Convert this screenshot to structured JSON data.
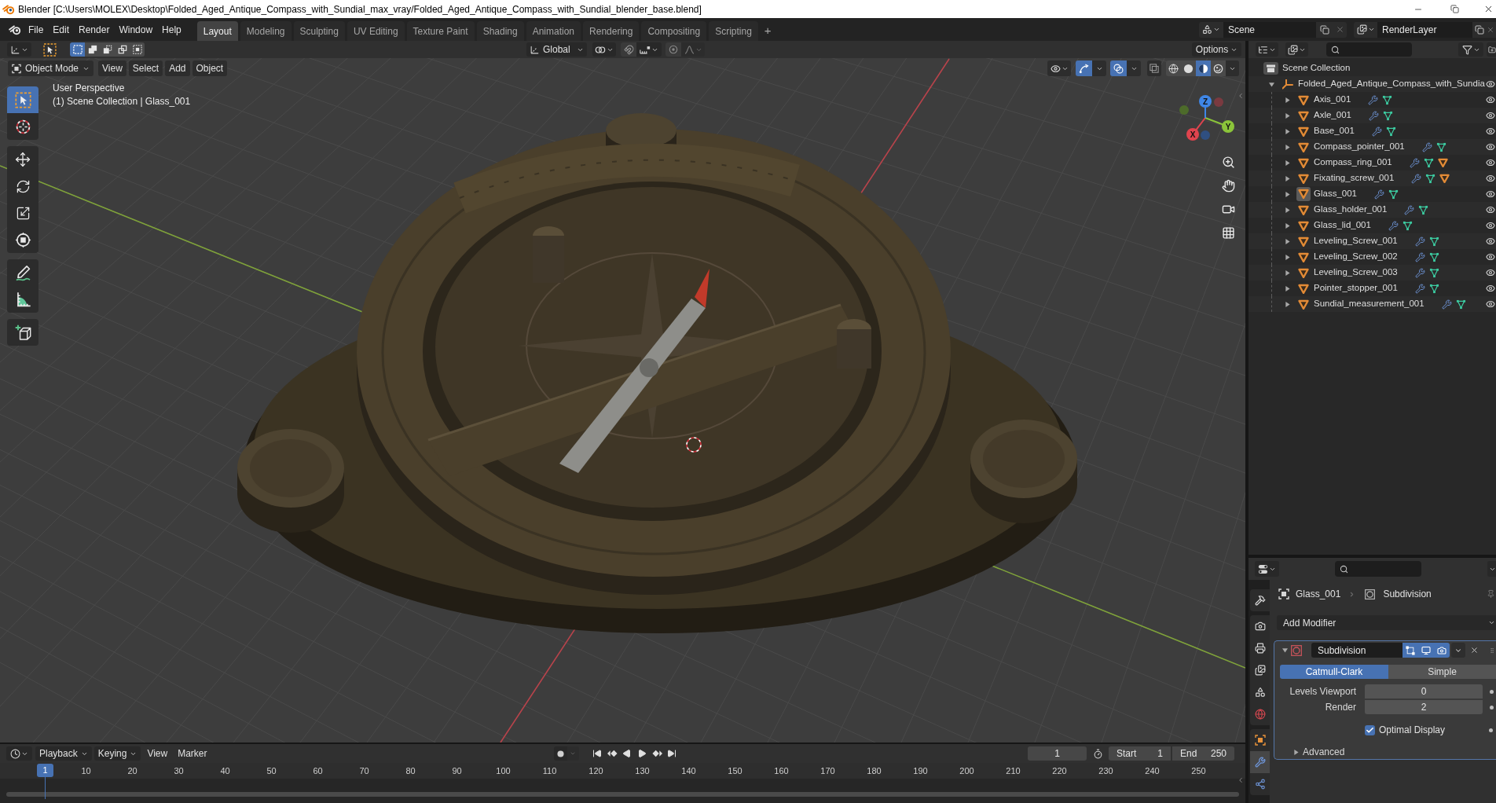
{
  "window": {
    "title": "Blender [C:\\Users\\MOLEX\\Desktop\\Folded_Aged_Antique_Compass_with_Sundial_max_vray/Folded_Aged_Antique_Compass_with_Sundial_blender_base.blend]"
  },
  "topbar": {
    "menus": [
      "File",
      "Edit",
      "Render",
      "Window",
      "Help"
    ],
    "workspaces": [
      {
        "label": "Layout",
        "selected": true
      },
      {
        "label": "Modeling",
        "selected": false
      },
      {
        "label": "Sculpting",
        "selected": false
      },
      {
        "label": "UV Editing",
        "selected": false
      },
      {
        "label": "Texture Paint",
        "selected": false
      },
      {
        "label": "Shading",
        "selected": false
      },
      {
        "label": "Animation",
        "selected": false
      },
      {
        "label": "Rendering",
        "selected": false
      },
      {
        "label": "Compositing",
        "selected": false
      },
      {
        "label": "Scripting",
        "selected": false
      }
    ],
    "add_workspace": "+",
    "scene": "Scene",
    "view_layer": "RenderLayer"
  },
  "viewport": {
    "header": {
      "select_modes": [
        {
          "kind": "set",
          "selected": true
        },
        {
          "kind": "extend",
          "selected": false
        },
        {
          "kind": "subtract",
          "selected": false
        },
        {
          "kind": "difference",
          "selected": false
        },
        {
          "kind": "intersect",
          "selected": false
        }
      ],
      "orientation": "Global",
      "options": "Options",
      "mode": "Object Mode",
      "menus": [
        "View",
        "Select",
        "Add",
        "Object"
      ],
      "gizmos_on": true,
      "overlays_on": true,
      "xray": false,
      "shading": [
        {
          "kind": "wireframe",
          "selected": false
        },
        {
          "kind": "solid",
          "selected": false
        },
        {
          "kind": "material",
          "selected": true
        },
        {
          "kind": "rendered",
          "selected": false
        }
      ]
    },
    "info": [
      "User Perspective",
      "(1) Scene Collection | Glass_001"
    ],
    "tools": [
      {
        "kind": "select_box",
        "selected": true
      },
      {
        "kind": "cursor",
        "selected": false
      },
      {
        "kind": "move",
        "selected": false
      },
      {
        "kind": "rotate",
        "selected": false
      },
      {
        "kind": "scale",
        "selected": false
      },
      {
        "kind": "transform",
        "selected": false
      },
      {
        "kind": "annotate",
        "selected": false
      },
      {
        "kind": "measure",
        "selected": false
      },
      {
        "kind": "add_cube",
        "selected": false
      }
    ],
    "gizmo_axes": [
      "X",
      "Y",
      "Z"
    ]
  },
  "outliner": {
    "tree": [
      {
        "kind": "collection",
        "name": "Scene Collection",
        "children": [
          {
            "kind": "empty",
            "name": "Folded_Aged_Antique_Compass_with_Sundia",
            "expanded": true,
            "active": false,
            "visible": true,
            "children": [
              {
                "kind": "mesh",
                "name": "Axis_001",
                "expanded": false,
                "active": false,
                "visible": true,
                "has_child": false
              },
              {
                "kind": "mesh",
                "name": "Axle_001",
                "expanded": false,
                "active": false,
                "visible": true,
                "has_child": false
              },
              {
                "kind": "mesh",
                "name": "Base_001",
                "expanded": false,
                "active": false,
                "visible": true,
                "has_child": false
              },
              {
                "kind": "mesh",
                "name": "Compass_pointer_001",
                "expanded": false,
                "active": false,
                "visible": true,
                "has_child": false
              },
              {
                "kind": "mesh",
                "name": "Compass_ring_001",
                "expanded": false,
                "active": false,
                "visible": true,
                "has_child": true
              },
              {
                "kind": "mesh",
                "name": "Fixating_screw_001",
                "expanded": false,
                "active": false,
                "visible": true,
                "has_child": true
              },
              {
                "kind": "mesh",
                "name": "Glass_001",
                "expanded": false,
                "active": true,
                "visible": true,
                "has_child": false
              },
              {
                "kind": "mesh",
                "name": "Glass_holder_001",
                "expanded": false,
                "active": false,
                "visible": true,
                "has_child": false
              },
              {
                "kind": "mesh",
                "name": "Glass_lid_001",
                "expanded": false,
                "active": false,
                "visible": true,
                "has_child": false
              },
              {
                "kind": "mesh",
                "name": "Leveling_Screw_001",
                "expanded": false,
                "active": false,
                "visible": true,
                "has_child": false
              },
              {
                "kind": "mesh",
                "name": "Leveling_Screw_002",
                "expanded": false,
                "active": false,
                "visible": true,
                "has_child": false
              },
              {
                "kind": "mesh",
                "name": "Leveling_Screw_003",
                "expanded": false,
                "active": false,
                "visible": true,
                "has_child": false
              },
              {
                "kind": "mesh",
                "name": "Pointer_stopper_001",
                "expanded": false,
                "active": false,
                "visible": true,
                "has_child": false
              },
              {
                "kind": "mesh",
                "name": "Sundial_measurement_001",
                "expanded": false,
                "active": false,
                "visible": true,
                "has_child": false
              }
            ]
          }
        ]
      }
    ]
  },
  "properties": {
    "tabs": [
      {
        "kind": "tool",
        "selected": false
      },
      {
        "kind": "render",
        "selected": false
      },
      {
        "kind": "output",
        "selected": false
      },
      {
        "kind": "view_layer",
        "selected": false
      },
      {
        "kind": "scene",
        "selected": false
      },
      {
        "kind": "world",
        "selected": false
      },
      {
        "kind": "object",
        "selected": false
      },
      {
        "kind": "modifiers",
        "selected": true
      },
      {
        "kind": "particles",
        "selected": false
      }
    ],
    "breadcrumb": [
      "Glass_001",
      "Subdivision"
    ],
    "add_modifier": "Add Modifier",
    "modifier": {
      "name": "Subdivision",
      "expanded": true,
      "edit_mode": true,
      "viewport": true,
      "render": true,
      "types": [
        {
          "label": "Catmull-Clark",
          "selected": true
        },
        {
          "label": "Simple",
          "selected": false
        }
      ],
      "fields": [
        {
          "label": "Levels Viewport",
          "value": "0"
        },
        {
          "label": "Render",
          "value": "2"
        }
      ],
      "optimal_display": {
        "label": "Optimal Display",
        "checked": true
      },
      "advanced": {
        "label": "Advanced",
        "expanded": false
      }
    }
  },
  "timeline": {
    "menus": [
      {
        "label": "Playback",
        "dropdown": true
      },
      {
        "label": "Keying",
        "dropdown": true
      },
      {
        "label": "View",
        "dropdown": false
      },
      {
        "label": "Marker",
        "dropdown": false
      }
    ],
    "auto_keying": false,
    "current_frame": "1",
    "start": {
      "label": "Start",
      "value": "1"
    },
    "end": {
      "label": "End",
      "value": "250"
    },
    "playhead": "1",
    "ticks": [
      "10",
      "20",
      "30",
      "40",
      "50",
      "60",
      "70",
      "80",
      "90",
      "100",
      "110",
      "120",
      "130",
      "140",
      "150",
      "160",
      "170",
      "180",
      "190",
      "200",
      "210",
      "220",
      "230",
      "240",
      "250"
    ]
  }
}
